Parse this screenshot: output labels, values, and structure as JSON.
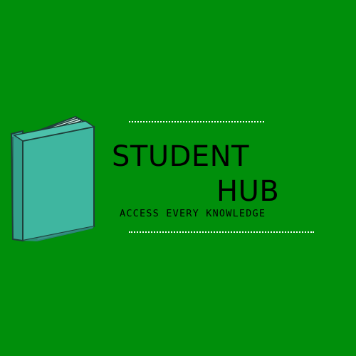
{
  "logo": {
    "title_line1": "STUDENT",
    "title_line2": "HUB",
    "tagline": "ACCESS EVERY KNOWLEDGE",
    "book_icon": "book-icon"
  },
  "colors": {
    "background": "#008f0b",
    "book_cover": "#3fb6a0",
    "book_spine": "#35a08d",
    "book_pages": "#dff5ef",
    "text": "#000000",
    "dotted_lines": "#ffffff"
  }
}
